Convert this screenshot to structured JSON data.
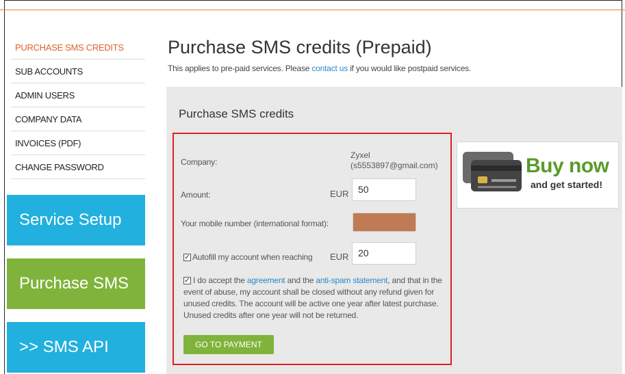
{
  "sidebar": {
    "items": [
      {
        "label": "PURCHASE SMS CREDITS"
      },
      {
        "label": "SUB ACCOUNTS"
      },
      {
        "label": "ADMIN USERS"
      },
      {
        "label": "COMPANY DATA"
      },
      {
        "label": "INVOICES (PDF)"
      },
      {
        "label": "CHANGE PASSWORD"
      }
    ],
    "tiles": {
      "service_setup": "Service Setup",
      "purchase_sms": "Purchase SMS",
      "sms_api": ">> SMS API"
    }
  },
  "main": {
    "title": "Purchase SMS credits (Prepaid)",
    "intro_before": "This applies to pre-paid services. Please ",
    "intro_link": "contact us",
    "intro_after": " if you would like postpaid services.",
    "panel_title": "Purchase SMS credits"
  },
  "form": {
    "company_label": "Company:",
    "company_name": "Zyxel",
    "company_email": "(s5553897@gmail.com)",
    "amount_label": "Amount:",
    "amount_currency": "EUR",
    "amount_value": "50",
    "mobile_label": "Your mobile number (international format):",
    "mobile_value": "",
    "autofill_label": "Autofill my account when reaching",
    "autofill_checked": true,
    "autofill_currency": "EUR",
    "autofill_value": "20",
    "terms_checked": true,
    "terms_before": "I do accept the ",
    "terms_link1": "agreement",
    "terms_middle": " and the ",
    "terms_link2": "anti-spam statement",
    "terms_after": ", and that in the event of abuse, my account shall be closed without any refund given for unused credits. The account will be active one year after latest purchase. Unused credits after one year will not be returned.",
    "pay_button": "GO TO PAYMENT"
  },
  "banner": {
    "headline": "Buy now",
    "subline": "and get started!",
    "icon": "credit-card-icon"
  },
  "colors": {
    "accent_orange": "#e0622a",
    "tile_blue": "#22b0de",
    "tile_green": "#80b33b",
    "link_blue": "#2b86c7",
    "highlight_red": "#e02020"
  }
}
